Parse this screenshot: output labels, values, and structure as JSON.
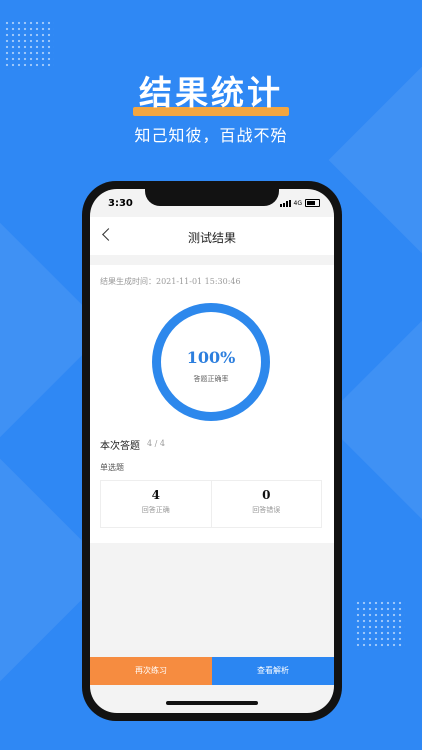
{
  "promo": {
    "title": "结果统计",
    "subtitle": "知己知彼，百战不殆",
    "accent_color": "#f3a640",
    "background_color": "#2f88f4"
  },
  "status_bar": {
    "time": "3:30",
    "network": "4G"
  },
  "nav": {
    "title": "测试结果",
    "back_icon": "chevron-left-icon"
  },
  "result": {
    "generated_time": "结果生成时间：2021-11-01 15:30:46",
    "accuracy_value": "100%",
    "accuracy_fraction": 1.0,
    "accuracy_label": "答题正确率"
  },
  "summary": {
    "title": "本次答题",
    "count": "4 / 4",
    "question_type": "单选题",
    "correct_count": "4",
    "correct_label": "回答正确",
    "wrong_count": "0",
    "wrong_label": "回答错误"
  },
  "actions": {
    "practice_again": "再次练习",
    "view_analysis": "查看解析"
  }
}
